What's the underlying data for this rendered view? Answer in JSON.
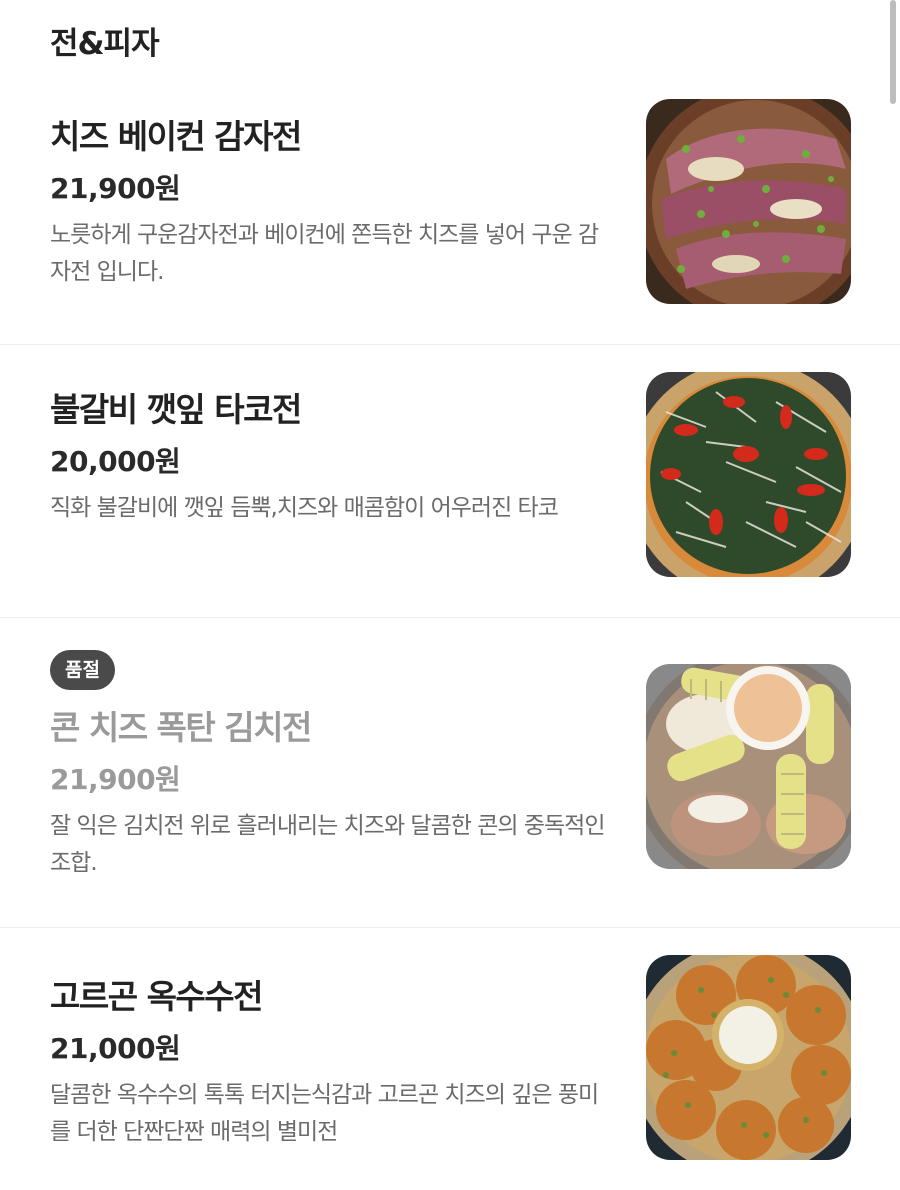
{
  "section": {
    "title": "전&피자"
  },
  "items": [
    {
      "name": "치즈 베이컨 감자전",
      "price": "21,900원",
      "description": "노릇하게 구운감자전과 베이컨에 쫀득한 치즈를 넣어 구운 감자전 입니다.",
      "image": "bacon-potato-pancake-photo"
    },
    {
      "name": "불갈비 깻잎 타코전",
      "price": "20,000원",
      "description": "직화 불갈비에 깻잎 듬뿍,치즈와 매콤함이 어우러진 타코",
      "image": "bulgalbi-perilla-taco-photo"
    },
    {
      "badge": "품절",
      "name": "콘 치즈 폭탄 김치전",
      "price": "21,900원",
      "description": "잘 익은 김치전 위로 흘러내리는 치즈와 달콤한 콘의 중독적인 조합.",
      "image": "corn-cheese-kimchi-pancake-photo"
    },
    {
      "name": "고르곤 옥수수전",
      "price": "21,000원",
      "description": "달콤한 옥수수의 톡톡 터지는식감과 고르곤 치즈의 깊은 풍미를 더한 단짠단짠 매력의 별미전",
      "image": "gorgon-corn-pancake-photo"
    }
  ]
}
